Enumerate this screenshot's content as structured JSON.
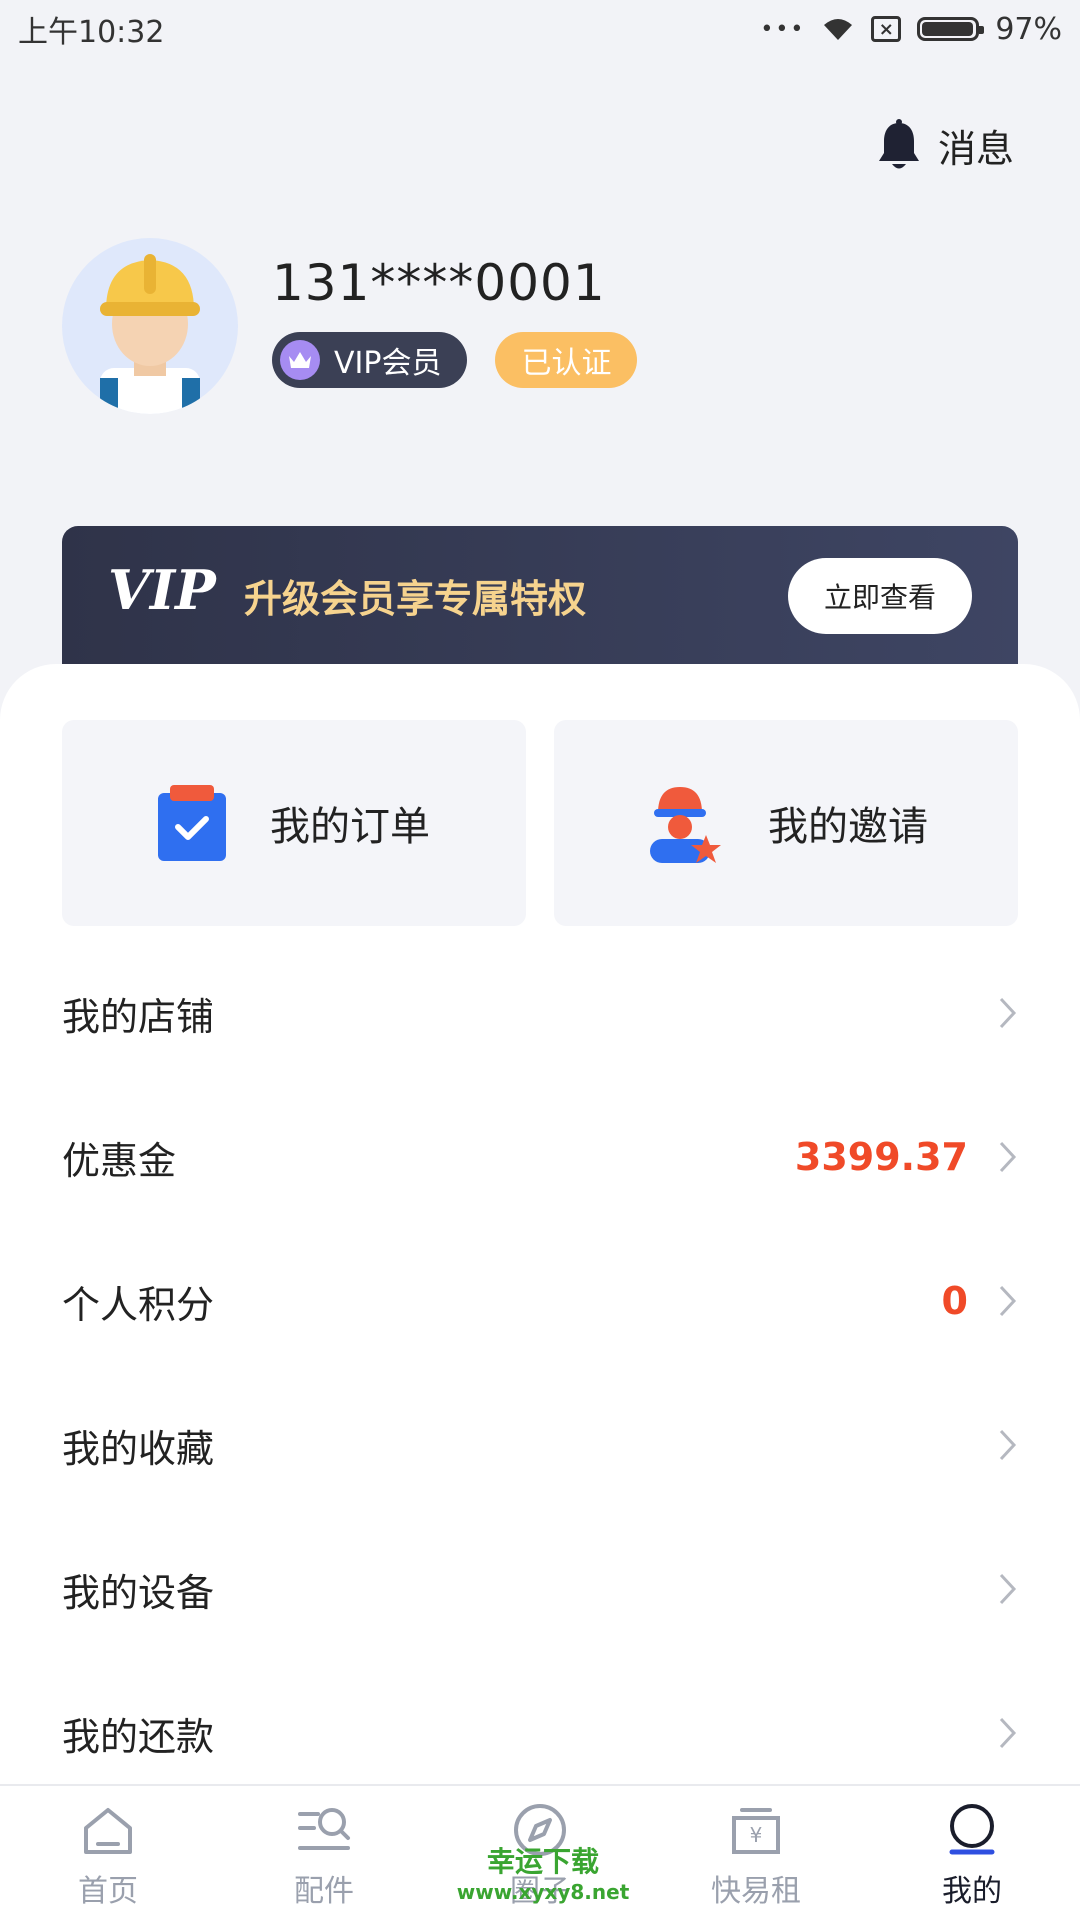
{
  "status_bar": {
    "time": "上午10:32",
    "dots": "•••",
    "battery": "97%",
    "battery_level": 0.97
  },
  "header": {
    "message_label": "消息"
  },
  "profile": {
    "phone": "131****0001",
    "vip_badge": "VIP会员",
    "certified_badge": "已认证"
  },
  "vip_banner": {
    "logo": "VIP",
    "title": "升级会员享专属特权",
    "button": "立即查看"
  },
  "quick_actions": [
    {
      "label": "我的订单",
      "icon": "order-clipboard-icon"
    },
    {
      "label": "我的邀请",
      "icon": "invite-worker-icon"
    }
  ],
  "menu": [
    {
      "label": "我的店铺",
      "value": ""
    },
    {
      "label": "优惠金",
      "value": "3399.37"
    },
    {
      "label": "个人积分",
      "value": "0"
    },
    {
      "label": "我的收藏",
      "value": ""
    },
    {
      "label": "我的设备",
      "value": ""
    },
    {
      "label": "我的还款",
      "value": ""
    }
  ],
  "tabs": [
    {
      "label": "首页",
      "icon": "home-icon"
    },
    {
      "label": "配件",
      "icon": "parts-search-icon"
    },
    {
      "label": "圈子",
      "icon": "compass-icon"
    },
    {
      "label": "快易租",
      "icon": "rent-box-icon"
    },
    {
      "label": "我的",
      "icon": "profile-icon"
    }
  ],
  "active_tab": "我的",
  "watermark": {
    "line1": "幸运下载",
    "line2": "www.xyxy8.net"
  },
  "colors": {
    "accent_value": "#f04a28",
    "vip_gold": "#f6d38e",
    "cert_orange": "#fbbf63"
  }
}
